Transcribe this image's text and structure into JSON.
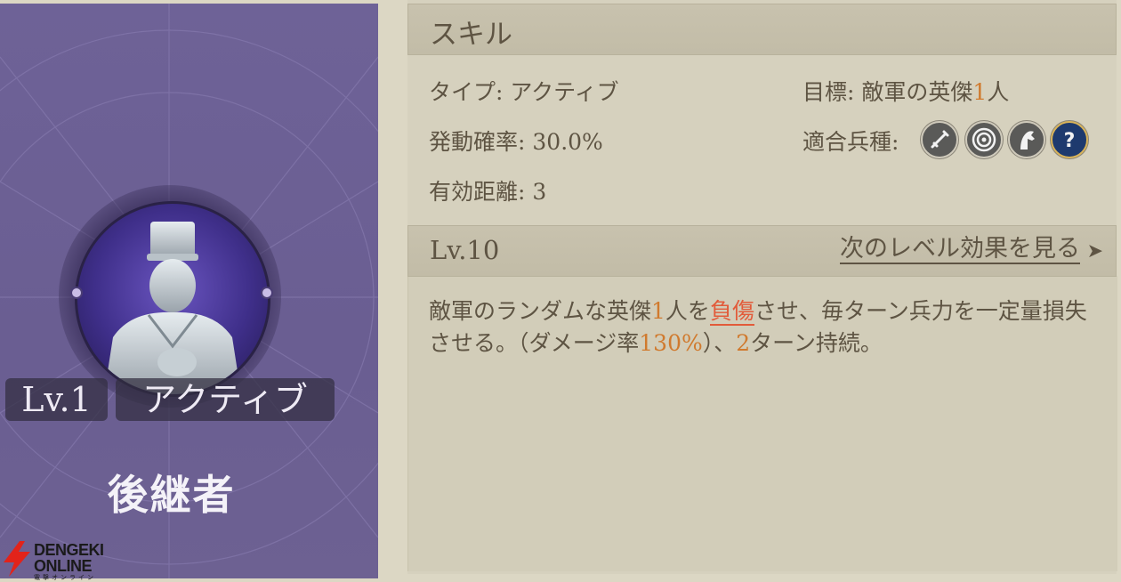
{
  "skill_card": {
    "level_tag": "Lv.1",
    "type_tag": "アクティブ",
    "skill_name": "後継者"
  },
  "logo": {
    "line1": "DENGEKI",
    "line2": "ONLINE",
    "line3": "電撃オンライン"
  },
  "skill_section": {
    "title": "スキル",
    "type_label": "タイプ:",
    "type_value": "アクティブ",
    "target_label": "目標:",
    "target_prefix": "敵軍の英傑",
    "target_count": "1",
    "target_suffix": "人",
    "chance_label": "発動確率:",
    "chance_value": "30.0%",
    "troops_label": "適合兵種:",
    "troop_icons": [
      "sword-icon",
      "target-icon",
      "horse-icon",
      "question-icon"
    ],
    "range_label": "有効距離:",
    "range_value": "3"
  },
  "level_section": {
    "level": "Lv.10",
    "next_level_link": "次のレベル効果を見る",
    "arrow": "➤"
  },
  "description": {
    "p1": "敵軍のランダムな英傑",
    "n1": "1",
    "p2": "人を",
    "status": "負傷",
    "p3": "させ、毎ターン兵力を一定量損失させる。（ダメージ率",
    "rate": "130%",
    "p4": "）、",
    "turns": "2",
    "p5": "ターン持続。"
  },
  "colors": {
    "accent": "#d07a2e",
    "status_red": "#e25b3a",
    "card_purple": "#6e6297"
  }
}
